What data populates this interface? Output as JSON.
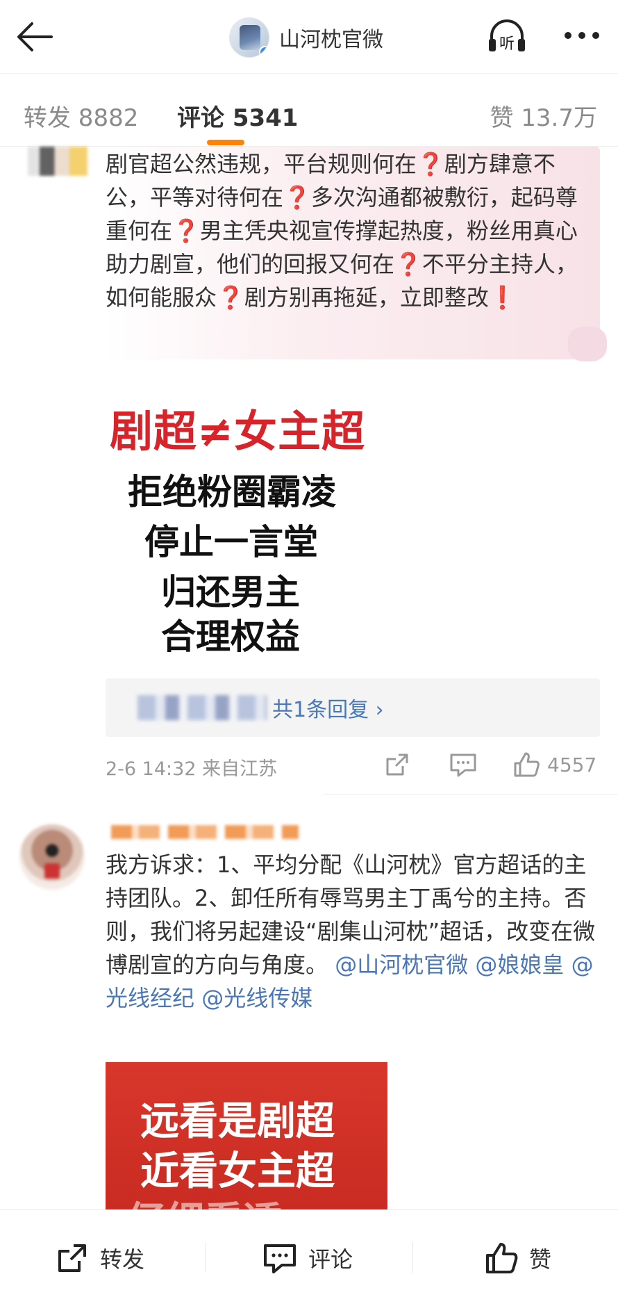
{
  "header": {
    "account_name": "山河枕官微",
    "listen_label": "听"
  },
  "tabs": {
    "repost": "转发 8882",
    "comments": "评论 5341",
    "likes": "赞 13.7万"
  },
  "comment1": {
    "segments": [
      "剧官超公然违规，平台规则何在",
      "剧方肆意不公，平等对待何在",
      "多次沟通都被敷衍，起码尊重何在",
      "男主凭央视宣传撑起热度，粉丝用真心助力剧宣，他们的回报又何在",
      "不平分主持人，如何能服众",
      "剧方别再拖延，立即整改"
    ],
    "q": "❓",
    "ex": "❗",
    "image_lines": {
      "red": "剧超≠女主超",
      "l1": "拒绝粉圈霸凌",
      "l2": "停止一言堂",
      "l3": "归还男主",
      "l4": "合理权益"
    },
    "reply_link": "共1条回复 ›",
    "meta": "2-6 14:32  来自江苏",
    "likes": "4557"
  },
  "comment2": {
    "text": "我方诉求：1、平均分配《山河枕》官方超话的主持团队。2、卸任所有辱骂男主丁禹兮的主持。否则，我们将另起建设“剧集山河枕”超话，改变在微博剧宣的方向与角度。",
    "mentions": [
      "@山河枕官微",
      "@娘娘皇",
      "@光线经纪",
      "@光线传媒"
    ],
    "image_lines": {
      "l1": "远看是剧超",
      "l2": "近看女主超",
      "l3": "仔细看透"
    }
  },
  "bottom_bar": {
    "repost": "转发",
    "comment": "评论",
    "like": "赞"
  },
  "colors": {
    "accent": "#ff8200",
    "link": "#4a77b8",
    "alert_red": "#e0202a"
  }
}
